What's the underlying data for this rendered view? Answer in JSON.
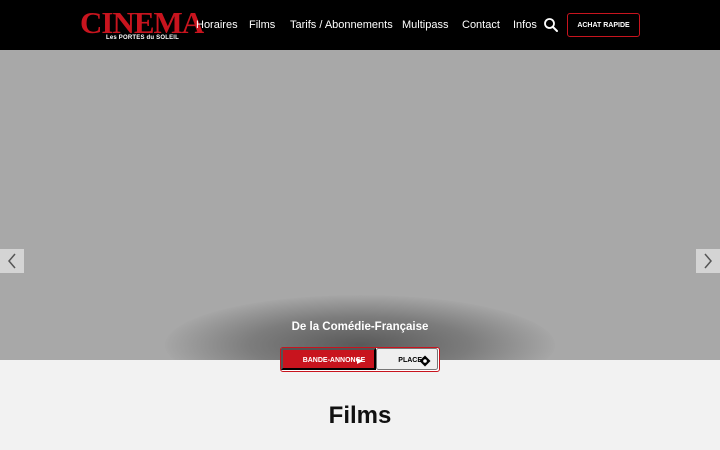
{
  "header": {
    "logo": {
      "main": "CINEMA",
      "sub": "Les PORTES du SOLEIL"
    },
    "nav": [
      "Horaires",
      "Films",
      "Tarifs / Abonnements",
      "Multipass",
      "Contact",
      "Infos"
    ],
    "achat_label": "ACHAT RAPIDE"
  },
  "hero": {
    "title": "De la Comédie-Française",
    "trailer_label": "BANDE-ANNONCE",
    "places_label": "PLACES"
  },
  "section": {
    "title": "Films"
  },
  "icons": {
    "search": "search-icon",
    "play": "play-icon",
    "ticket": "ticket-icon",
    "prev": "chevron-left-icon",
    "next": "chevron-right-icon"
  },
  "colors": {
    "brand_red": "#c8141e",
    "header_bg": "#000000",
    "hero_bg": "#a8a8a8",
    "page_bg": "#f2f2f2"
  }
}
